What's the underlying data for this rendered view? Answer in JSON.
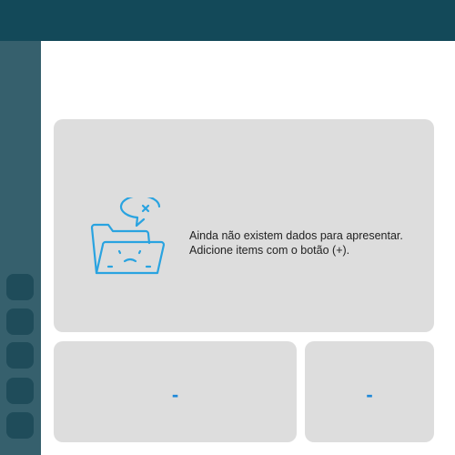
{
  "colors": {
    "topbar": "#134959",
    "sidebar": "#36606d",
    "sidebar_button": "#1f4c5a",
    "panel": "#dddddd",
    "accent": "#1e88d8",
    "illustration": "#29a3e0"
  },
  "sidebar": {
    "buttons": [
      {
        "icon": "sidebar-button-1"
      },
      {
        "icon": "sidebar-button-2"
      },
      {
        "icon": "sidebar-button-3"
      },
      {
        "icon": "sidebar-button-4"
      },
      {
        "icon": "sidebar-button-5"
      }
    ]
  },
  "empty_state": {
    "icon": "sad-folder-icon",
    "line1": "Ainda não existem dados para apresentar.",
    "line2": "Adicione items com o botão (+)."
  },
  "cards": {
    "left_value": "-",
    "right_value": "-"
  }
}
